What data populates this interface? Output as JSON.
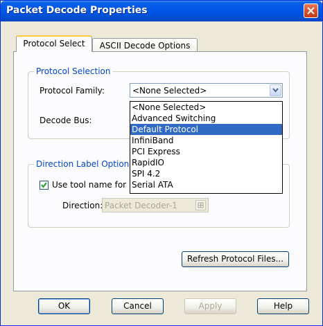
{
  "window": {
    "title": "Packet Decode Properties"
  },
  "tabs": [
    {
      "label": "Protocol Select",
      "active": true
    },
    {
      "label": "ASCII Decode Options",
      "active": false
    }
  ],
  "protocol_selection": {
    "group_label": "Protocol Selection",
    "family_label": "Protocol Family:",
    "family_value": "<None Selected>",
    "decode_bus_label": "Decode Bus:",
    "dropdown_options": [
      "<None Selected>",
      "Advanced Switching",
      "Default Protocol",
      "InfiniBand",
      "PCI Express",
      "RapidIO",
      "SPI 4.2",
      "Serial ATA"
    ],
    "highlighted_option": "Default Protocol"
  },
  "direction": {
    "group_label": "Direction Label Option",
    "checkbox_label": "Use tool name for",
    "checkbox_checked": true,
    "direction_label": "Direction:",
    "direction_value": "Packet Decoder-1"
  },
  "buttons": {
    "refresh": "Refresh Protocol Files...",
    "ok": "OK",
    "cancel": "Cancel",
    "apply": "Apply",
    "help": "Help"
  },
  "colors": {
    "titlebar": "#0058e8",
    "group_label": "#0046d5",
    "selection": "#316ac5",
    "close": "#d9522b"
  }
}
